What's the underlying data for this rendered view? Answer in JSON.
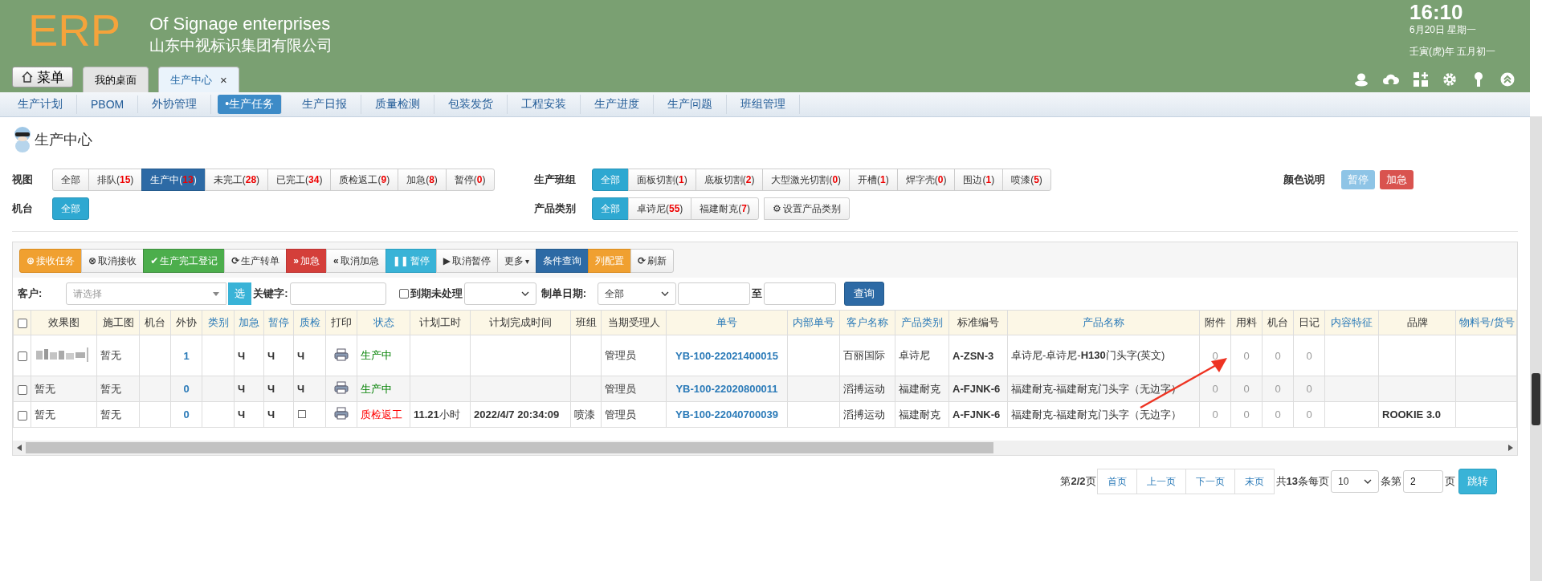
{
  "header": {
    "logo": "ERP",
    "title": "Of Signage enterprises",
    "subtitle": "山东中视标识集团有限公司",
    "time": "16:10",
    "date": "6月20日 星期一",
    "lunar": "壬寅(虎)年 五月初一",
    "menu_button": "菜单"
  },
  "tabs": [
    {
      "label": "我的桌面",
      "selected": false
    },
    {
      "label": "生产中心",
      "selected": true,
      "close": "×"
    }
  ],
  "nav": [
    {
      "label": "生产计划",
      "selected": false
    },
    {
      "label": "PBOM",
      "selected": false
    },
    {
      "label": "外协管理",
      "selected": false
    },
    {
      "label": "•生产任务",
      "selected": true
    },
    {
      "label": "生产日报",
      "selected": false
    },
    {
      "label": "质量检测",
      "selected": false
    },
    {
      "label": "包装发货",
      "selected": false
    },
    {
      "label": "工程安装",
      "selected": false
    },
    {
      "label": "生产进度",
      "selected": false
    },
    {
      "label": "生产问题",
      "selected": false
    },
    {
      "label": "班组管理",
      "selected": false
    }
  ],
  "page_title": "生产中心",
  "filters": {
    "view": {
      "label": "视图",
      "options": [
        {
          "label": "全部",
          "selected": false
        },
        {
          "label": "排队(",
          "count": "15",
          "close": ")",
          "selected": false
        },
        {
          "label": "生产中(",
          "count": "13",
          "close": ")",
          "selected": true
        },
        {
          "label": "未完工(",
          "count": "28",
          "close": ")",
          "selected": false
        },
        {
          "label": "已完工(",
          "count": "34",
          "close": ")",
          "selected": false
        },
        {
          "label": "质检返工(",
          "count": "9",
          "close": ")",
          "selected": false
        },
        {
          "label": "加急(",
          "count": "8",
          "close": ")",
          "selected": false
        },
        {
          "label": "暂停(",
          "count": "0",
          "close": ")",
          "selected": false
        }
      ]
    },
    "team": {
      "label": "生产班组",
      "options": [
        {
          "label": "全部",
          "selected": true
        },
        {
          "label": "面板切割(",
          "count": "1",
          "close": ")",
          "selected": false
        },
        {
          "label": "底板切割(",
          "count": "2",
          "close": ")",
          "selected": false
        },
        {
          "label": "大型激光切割(",
          "count": "0",
          "close": ")",
          "selected": false
        },
        {
          "label": "开槽(",
          "count": "1",
          "close": ")",
          "selected": false
        },
        {
          "label": "焊字壳(",
          "count": "0",
          "close": ")",
          "selected": false
        },
        {
          "label": "围边(",
          "count": "1",
          "close": ")",
          "selected": false
        },
        {
          "label": "喷漆(",
          "count": "5",
          "close": ")",
          "selected": false
        }
      ]
    },
    "machine": {
      "label": "机台",
      "options": [
        {
          "label": "全部",
          "selected": true
        }
      ]
    },
    "category": {
      "label": "产品类别",
      "options": [
        {
          "label": "全部",
          "selected": true
        },
        {
          "label": "卓诗尼(",
          "count": "55",
          "close": ")",
          "selected": false
        },
        {
          "label": "福建耐克(",
          "count": "7",
          "close": ")",
          "selected": false
        }
      ],
      "settings_icon": "⚙",
      "settings_button": "设置产品类别"
    },
    "legend": {
      "label": "颜色说明",
      "items": [
        {
          "label": "暂停",
          "color": "#8ec4e6"
        },
        {
          "label": "加急",
          "color": "#d9534f"
        }
      ]
    }
  },
  "toolbar": [
    {
      "icon": "⊕",
      "label": "接收任务",
      "kind": "warning"
    },
    {
      "icon": "⊗",
      "label": "取消接收",
      "kind": "default"
    },
    {
      "icon": "✔",
      "label": "生产完工登记",
      "kind": "success"
    },
    {
      "icon": "⟳",
      "label": "生产转单",
      "kind": "default"
    },
    {
      "icon": "»",
      "label": "加急",
      "kind": "danger"
    },
    {
      "icon": "«",
      "label": "取消加急",
      "kind": "default"
    },
    {
      "icon": "❚❚",
      "label": "暂停",
      "kind": "info"
    },
    {
      "icon": "▶",
      "label": "取消暂停",
      "kind": "default"
    },
    {
      "label": "更多",
      "caret": "▾",
      "kind": "default"
    },
    {
      "label": "条件查询",
      "kind": "primary"
    },
    {
      "label": "列配置",
      "kind": "warning"
    },
    {
      "icon": "⟳",
      "label": "刷新",
      "kind": "default"
    }
  ],
  "search": {
    "customer_label": "客户:",
    "customer_placeholder": "请选择",
    "pick_button": "选",
    "keyword_label": "关键字:",
    "overdue_label": "到期未处理",
    "overdue_checked": false,
    "date_label": "制单日期:",
    "date_range": "全部",
    "to_label": "至",
    "query_button": "查询"
  },
  "table": {
    "select_all_checked": false,
    "columns": [
      {
        "label": "效果图",
        "sortable": false
      },
      {
        "label": "施工图",
        "sortable": false
      },
      {
        "label": "机台",
        "sortable": false
      },
      {
        "label": "外协",
        "sortable": false
      },
      {
        "label": "类别",
        "sortable": true
      },
      {
        "label": "加急",
        "sortable": true
      },
      {
        "label": "暂停",
        "sortable": true
      },
      {
        "label": "质检",
        "sortable": true
      },
      {
        "label": "打印",
        "sortable": false
      },
      {
        "label": "状态",
        "sortable": true
      },
      {
        "label": "计划工时",
        "sortable": false
      },
      {
        "label": "计划完成时间",
        "sortable": false
      },
      {
        "label": "班组",
        "sortable": false
      },
      {
        "label": "当期受理人",
        "sortable": false
      },
      {
        "label": "单号",
        "sortable": true
      },
      {
        "label": "内部单号",
        "sortable": true
      },
      {
        "label": "客户名称",
        "sortable": true
      },
      {
        "label": "产品类别",
        "sortable": true
      },
      {
        "label": "标准编号",
        "sortable": false
      },
      {
        "label": "产品名称",
        "sortable": true
      },
      {
        "label": "附件",
        "sortable": false
      },
      {
        "label": "用料",
        "sortable": false
      },
      {
        "label": "机台",
        "sortable": false
      },
      {
        "label": "日记",
        "sortable": false
      },
      {
        "label": "内容特征",
        "sortable": true
      },
      {
        "label": "品牌",
        "sortable": false
      },
      {
        "label": "物料号/货号",
        "sortable": true
      }
    ],
    "rows": [
      {
        "checked": false,
        "cells": [
          {
            "kind": "picture"
          },
          {
            "kind": "text",
            "text": "暂无"
          },
          {
            "kind": "blank"
          },
          {
            "kind": "link",
            "text": "1"
          },
          {
            "kind": "blank"
          },
          {
            "kind": "bold",
            "text": "Ч"
          },
          {
            "kind": "bold",
            "text": "Ч"
          },
          {
            "kind": "bold",
            "text": "Ч"
          },
          {
            "kind": "printer"
          },
          {
            "kind": "status_running",
            "text": "生产中"
          },
          {
            "kind": "blank"
          },
          {
            "kind": "blank"
          },
          {
            "kind": "blank"
          },
          {
            "kind": "text",
            "text": "管理员"
          },
          {
            "kind": "link",
            "text": "YB-100-22021400015"
          },
          {
            "kind": "blank"
          },
          {
            "kind": "text",
            "text": "百丽国际"
          },
          {
            "kind": "text",
            "text": "卓诗尼"
          },
          {
            "kind": "bold",
            "text": "A-ZSN-3"
          },
          {
            "kind": "rich",
            "text": "卓诗尼-卓诗尼-**H130**门头字(英文)"
          },
          {
            "kind": "zero",
            "text": "0"
          },
          {
            "kind": "zero",
            "text": "0"
          },
          {
            "kind": "zero",
            "text": "0"
          },
          {
            "kind": "zero",
            "text": "0"
          },
          {
            "kind": "blank"
          },
          {
            "kind": "blank"
          },
          {
            "kind": "blank"
          }
        ]
      },
      {
        "checked": false,
        "cells": [
          {
            "kind": "text",
            "text": "暂无"
          },
          {
            "kind": "text",
            "text": "暂无"
          },
          {
            "kind": "blank"
          },
          {
            "kind": "link",
            "text": "0"
          },
          {
            "kind": "blank"
          },
          {
            "kind": "bold",
            "text": "Ч"
          },
          {
            "kind": "bold",
            "text": "Ч"
          },
          {
            "kind": "bold",
            "text": "Ч"
          },
          {
            "kind": "printer"
          },
          {
            "kind": "status_running",
            "text": "生产中"
          },
          {
            "kind": "blank"
          },
          {
            "kind": "blank"
          },
          {
            "kind": "blank"
          },
          {
            "kind": "text",
            "text": "管理员"
          },
          {
            "kind": "link",
            "text": "YB-100-22020800011"
          },
          {
            "kind": "blank"
          },
          {
            "kind": "text",
            "text": "滔搏运动"
          },
          {
            "kind": "text",
            "text": "福建耐克"
          },
          {
            "kind": "bold",
            "text": "A-FJNK-6"
          },
          {
            "kind": "text",
            "text": "福建耐克-福建耐克门头字（无边字）"
          },
          {
            "kind": "zero",
            "text": "0"
          },
          {
            "kind": "zero",
            "text": "0"
          },
          {
            "kind": "zero",
            "text": "0"
          },
          {
            "kind": "zero",
            "text": "0"
          },
          {
            "kind": "blank"
          },
          {
            "kind": "blank"
          },
          {
            "kind": "blank"
          }
        ]
      },
      {
        "checked": false,
        "cells": [
          {
            "kind": "text",
            "text": "暂无"
          },
          {
            "kind": "text",
            "text": "暂无"
          },
          {
            "kind": "blank"
          },
          {
            "kind": "link",
            "text": "0"
          },
          {
            "kind": "blank"
          },
          {
            "kind": "bold",
            "text": "Ч"
          },
          {
            "kind": "bold",
            "text": "Ч"
          },
          {
            "kind": "text",
            "text": "☐"
          },
          {
            "kind": "printer"
          },
          {
            "kind": "status_rework",
            "text": "质检返工"
          },
          {
            "kind": "rich",
            "text": "**11.21**小时"
          },
          {
            "kind": "bold",
            "text": "2022/4/7 20:34:09"
          },
          {
            "kind": "text",
            "text": "喷漆"
          },
          {
            "kind": "text",
            "text": "管理员"
          },
          {
            "kind": "link",
            "text": "YB-100-22040700039"
          },
          {
            "kind": "blank"
          },
          {
            "kind": "text",
            "text": "滔搏运动"
          },
          {
            "kind": "text",
            "text": "福建耐克"
          },
          {
            "kind": "bold",
            "text": "A-FJNK-6"
          },
          {
            "kind": "text",
            "text": "福建耐克-福建耐克门头字（无边字）"
          },
          {
            "kind": "zero",
            "text": "0"
          },
          {
            "kind": "zero",
            "text": "0"
          },
          {
            "kind": "zero",
            "text": "0"
          },
          {
            "kind": "zero",
            "text": "0"
          },
          {
            "kind": "blank"
          },
          {
            "kind": "bold",
            "text": "ROOKIE 3.0"
          },
          {
            "kind": "blank"
          }
        ]
      }
    ]
  },
  "pager": {
    "info": "第**2/2**页",
    "buttons": [
      "首页",
      "上一页",
      "下一页",
      "末页"
    ],
    "total": "共**13**条每页",
    "page_size": "10",
    "page_label": "条第",
    "page_value": "2",
    "page_unit": "页",
    "go_button": "跳转"
  }
}
